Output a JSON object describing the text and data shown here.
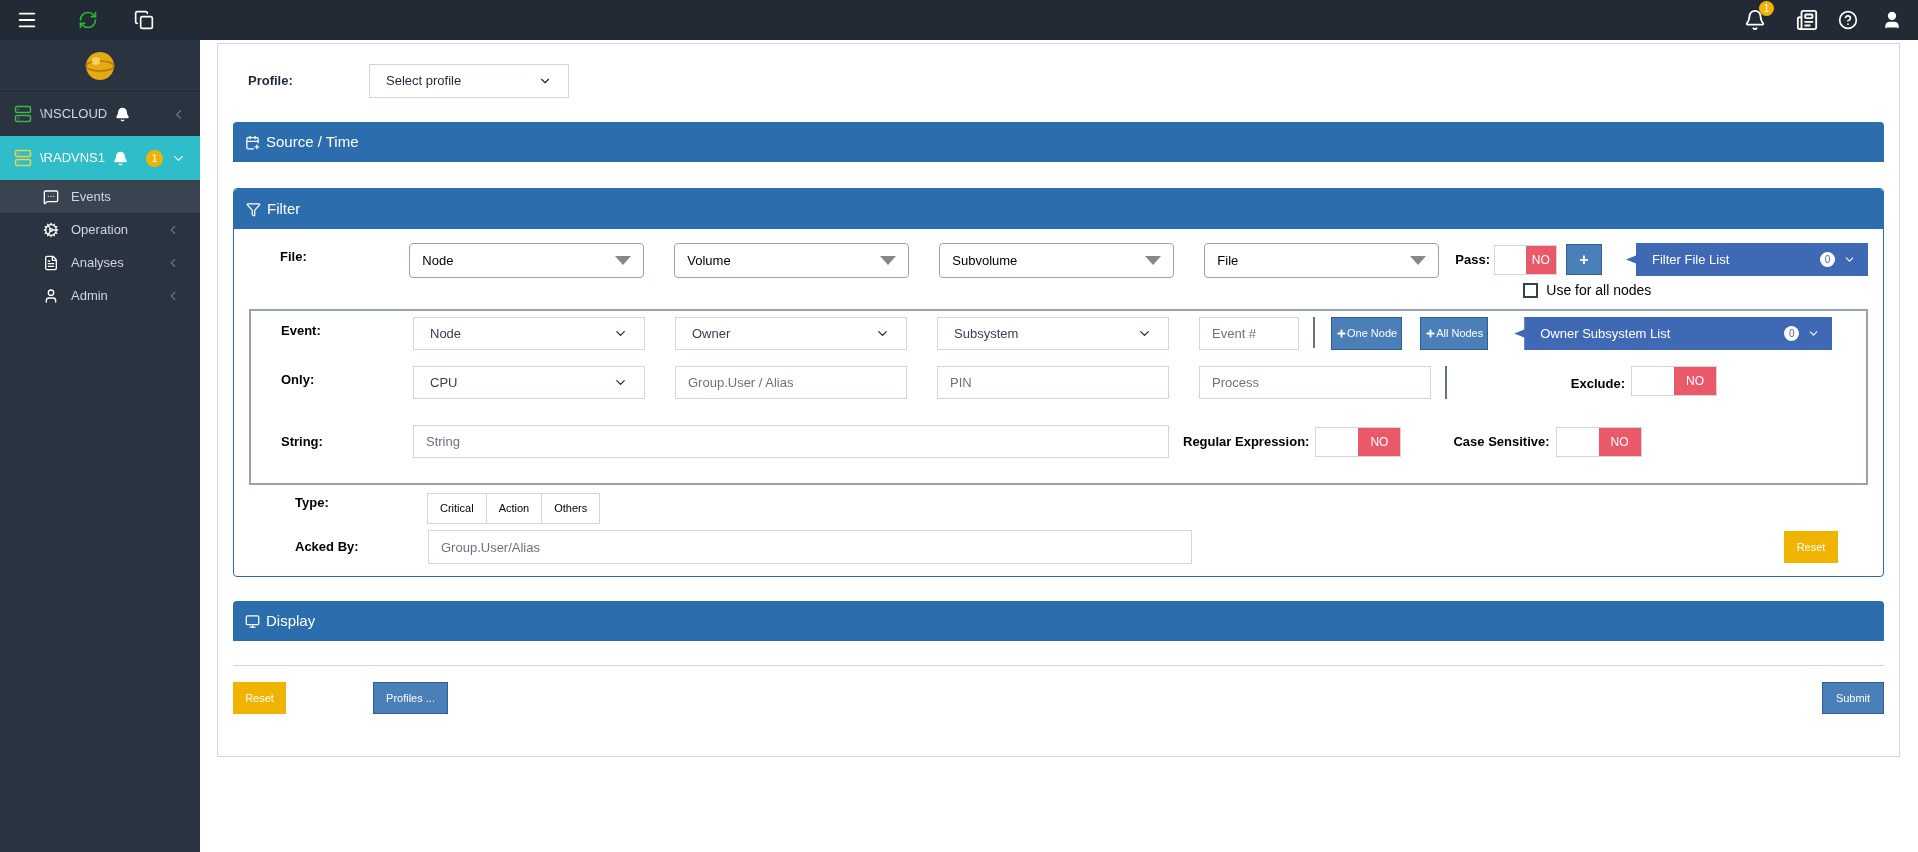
{
  "topbar": {
    "notification_count": "1"
  },
  "sidebar": {
    "nodes": [
      {
        "name": "\\NSCLOUD",
        "selected": false,
        "expanded": false
      },
      {
        "name": "\\RADVNS1",
        "selected": true,
        "expanded": true,
        "badge": "1",
        "children": [
          {
            "label": "Events",
            "selected": true,
            "expandable": false
          },
          {
            "label": "Operation",
            "selected": false,
            "expandable": true
          },
          {
            "label": "Analyses",
            "selected": false,
            "expandable": true
          },
          {
            "label": "Admin",
            "selected": false,
            "expandable": true
          }
        ]
      }
    ]
  },
  "profile": {
    "label": "Profile:",
    "value": "Select profile"
  },
  "source_time": {
    "title": "Source / Time"
  },
  "filter": {
    "title": "Filter",
    "file": {
      "label": "File:",
      "combos": [
        "Node",
        "Volume",
        "Subvolume",
        "File"
      ],
      "pass": {
        "label": "Pass:",
        "on": false,
        "text": "NO"
      },
      "add": "+",
      "list": {
        "title": "Filter File List",
        "count": "0"
      },
      "use_for_all": {
        "label": "Use for all nodes",
        "checked": false
      }
    },
    "event": {
      "label": "Event:",
      "fields": [
        {
          "kind": "select",
          "value": "Node"
        },
        {
          "kind": "select",
          "value": "Owner"
        },
        {
          "kind": "select",
          "value": "Subsystem"
        },
        {
          "kind": "input",
          "placeholder": "Event #"
        }
      ],
      "one_node": "One Node",
      "all_nodes": "All Nodes",
      "list": {
        "title": "Owner Subsystem List",
        "count": "0"
      }
    },
    "only": {
      "label": "Only:",
      "fields": [
        {
          "kind": "select",
          "value": "CPU"
        },
        {
          "kind": "input",
          "placeholder": "Group.User / Alias"
        },
        {
          "kind": "input",
          "placeholder": "PIN"
        },
        {
          "kind": "input",
          "placeholder": "Process"
        }
      ],
      "exclude": {
        "label": "Exclude:",
        "on": false,
        "text": "NO"
      }
    },
    "string": {
      "label": "String:",
      "placeholder": "String",
      "regex": {
        "label": "Regular Expression:",
        "on": false,
        "text": "NO"
      },
      "case": {
        "label": "Case Sensitive:",
        "on": false,
        "text": "NO"
      }
    },
    "type": {
      "label": "Type:",
      "options": [
        "Critical",
        "Action",
        "Others"
      ]
    },
    "acked_by": {
      "label": "Acked By:",
      "placeholder": "Group.User/Alias"
    },
    "reset": "Reset"
  },
  "display": {
    "title": "Display"
  },
  "footer": {
    "reset": "Reset",
    "profiles": "Profiles ...",
    "submit": "Submit"
  }
}
